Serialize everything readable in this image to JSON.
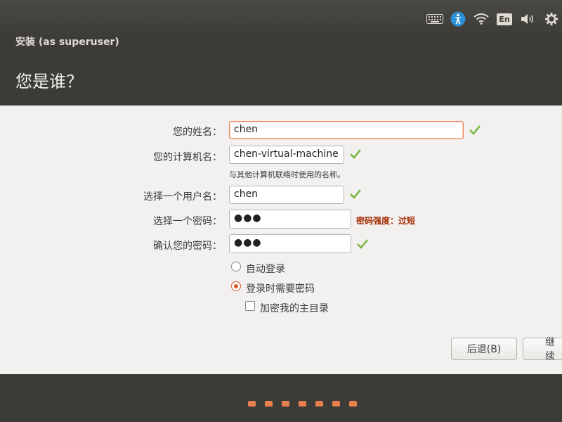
{
  "tray": {
    "language": "En"
  },
  "header": {
    "subtitle": "安装 (as superuser)",
    "title": "您是谁？"
  },
  "form": {
    "name": {
      "label": "您的姓名：",
      "value": "chen"
    },
    "computer": {
      "label": "您的计算机名：",
      "value": "chen-virtual-machine",
      "hint": "与其他计算机联络时使用的名称。"
    },
    "username": {
      "label": "选择一个用户名：",
      "value": "chen"
    },
    "password": {
      "label": "选择一个密码：",
      "value": "●●●",
      "strength": "密码强度：过短"
    },
    "confirm": {
      "label": "确认您的密码：",
      "value": "●●●"
    },
    "auto_login": "自动登录",
    "require_password": "登录时需要密码",
    "encrypt_home": "加密我的主目录"
  },
  "buttons": {
    "back": "后退(B)",
    "continue": "继续"
  },
  "colors": {
    "accent": "#e8804e",
    "check": "#7ab23b",
    "warn": "#a52a00"
  }
}
